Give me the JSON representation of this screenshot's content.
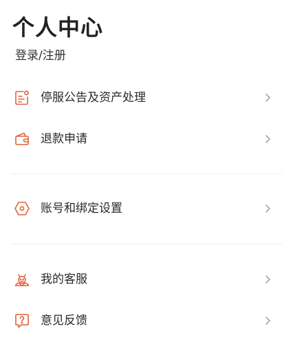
{
  "header": {
    "title": "个人中心",
    "login_label": "登录/注册"
  },
  "colors": {
    "accent": "#E0623A",
    "chevron": "#9A9A9A",
    "divider": "#EEEEEE"
  },
  "menu": {
    "group1": [
      {
        "label": "停服公告及资产处理",
        "icon": "notice-document-icon"
      },
      {
        "label": "退款申请",
        "icon": "wallet-icon"
      }
    ],
    "group2": [
      {
        "label": "账号和绑定设置",
        "icon": "hexagon-settings-icon"
      }
    ],
    "group3": [
      {
        "label": "我的客服",
        "icon": "customer-service-icon"
      },
      {
        "label": "意见反馈",
        "icon": "feedback-question-icon"
      }
    ]
  }
}
